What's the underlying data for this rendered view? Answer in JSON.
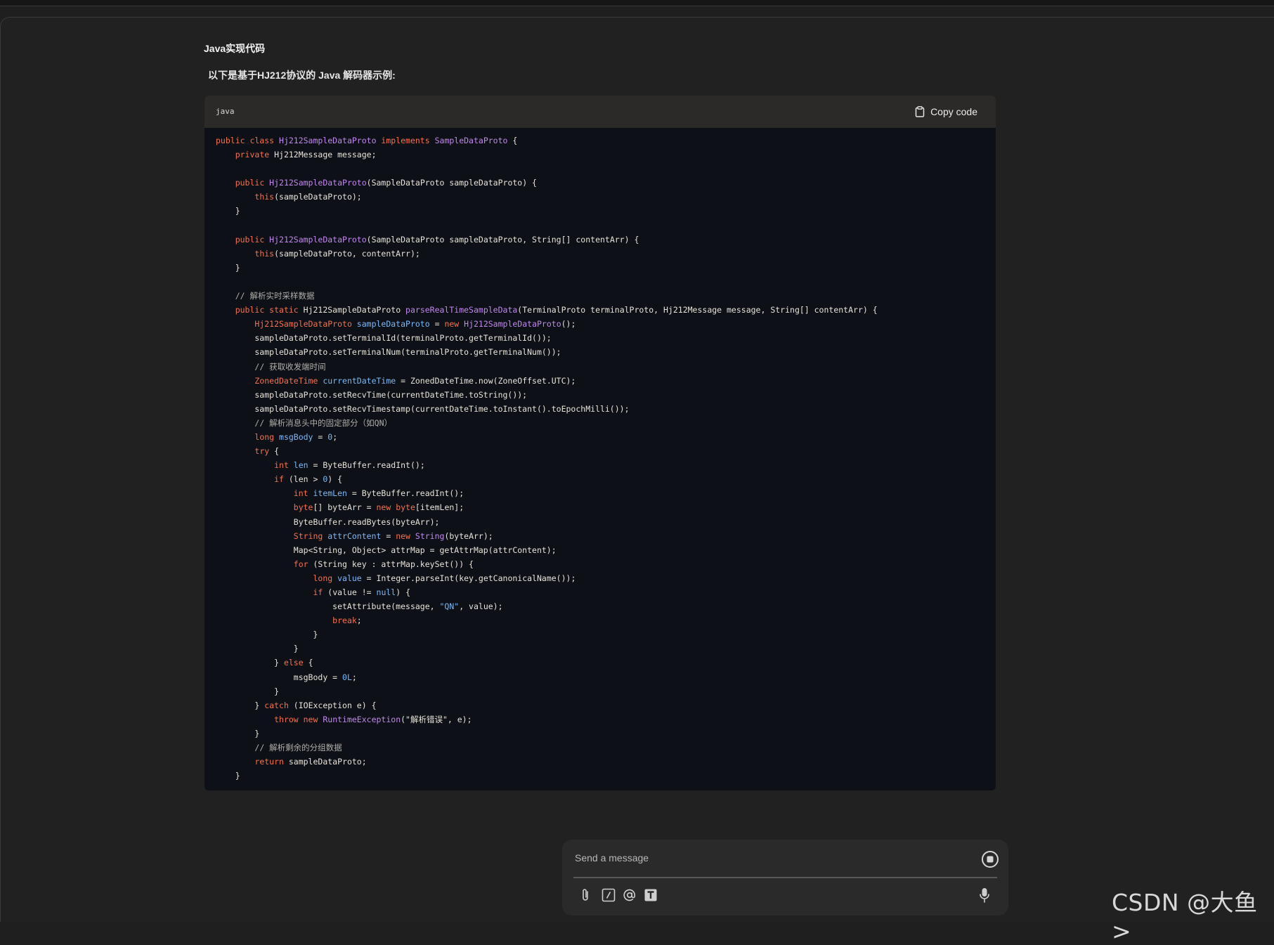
{
  "page": {
    "heading": "Java实现代码",
    "intro": "以下是基于HJ212协议的 Java 解码器示例:"
  },
  "code_block": {
    "language": "java",
    "copy_label": "Copy code",
    "lines": [
      [
        {
          "t": "public class ",
          "c": "kw"
        },
        {
          "t": "Hj212SampleDataProto ",
          "c": "cls"
        },
        {
          "t": "implements ",
          "c": "kw"
        },
        {
          "t": "SampleDataProto",
          "c": "cls"
        },
        {
          "t": " {"
        }
      ],
      [
        {
          "t": "    "
        },
        {
          "t": "private ",
          "c": "kw"
        },
        {
          "t": "Hj212Message message;"
        }
      ],
      [],
      [
        {
          "t": "    "
        },
        {
          "t": "public ",
          "c": "kw"
        },
        {
          "t": "Hj212SampleDataProto",
          "c": "cls"
        },
        {
          "t": "(SampleDataProto sampleDataProto) {"
        }
      ],
      [
        {
          "t": "        "
        },
        {
          "t": "this",
          "c": "kw"
        },
        {
          "t": "(sampleDataProto);"
        }
      ],
      [
        {
          "t": "    }"
        }
      ],
      [],
      [
        {
          "t": "    "
        },
        {
          "t": "public ",
          "c": "kw"
        },
        {
          "t": "Hj212SampleDataProto",
          "c": "cls"
        },
        {
          "t": "(SampleDataProto sampleDataProto, String[] contentArr) {"
        }
      ],
      [
        {
          "t": "        "
        },
        {
          "t": "this",
          "c": "kw"
        },
        {
          "t": "(sampleDataProto, contentArr);"
        }
      ],
      [
        {
          "t": "    }"
        }
      ],
      [],
      [
        {
          "t": "    "
        },
        {
          "t": "// 解析实时采样数据",
          "c": "cm"
        }
      ],
      [
        {
          "t": "    "
        },
        {
          "t": "public static ",
          "c": "kw"
        },
        {
          "t": "Hj212SampleDataProto "
        },
        {
          "t": "parseRealTimeSampleData",
          "c": "cls"
        },
        {
          "t": "(TerminalProto terminalProto, Hj212Message message, String[] contentArr) {"
        }
      ],
      [
        {
          "t": "        "
        },
        {
          "t": "Hj212SampleDataProto ",
          "c": "kw"
        },
        {
          "t": "sampleDataProto",
          "c": "nm"
        },
        {
          "t": " = "
        },
        {
          "t": "new ",
          "c": "kw"
        },
        {
          "t": "Hj212SampleDataProto",
          "c": "cls"
        },
        {
          "t": "();"
        }
      ],
      [
        {
          "t": "        sampleDataProto.setTerminalId(terminalProto.getTerminalId());"
        }
      ],
      [
        {
          "t": "        sampleDataProto.setTerminalNum(terminalProto.getTerminalNum());"
        }
      ],
      [
        {
          "t": "        "
        },
        {
          "t": "// 获取收发端时间",
          "c": "cm"
        }
      ],
      [
        {
          "t": "        "
        },
        {
          "t": "ZonedDateTime ",
          "c": "kw"
        },
        {
          "t": "currentDateTime",
          "c": "nm"
        },
        {
          "t": " = ZonedDateTime.now(ZoneOffset.UTC);"
        }
      ],
      [
        {
          "t": "        sampleDataProto.setRecvTime(currentDateTime.toString());"
        }
      ],
      [
        {
          "t": "        sampleDataProto.setRecvTimestamp(currentDateTime.toInstant().toEpochMilli());"
        }
      ],
      [
        {
          "t": "        "
        },
        {
          "t": "// 解析消息头中的固定部分（如QN）",
          "c": "cm"
        }
      ],
      [
        {
          "t": "        "
        },
        {
          "t": "long ",
          "c": "kw"
        },
        {
          "t": "msgBody",
          "c": "nm"
        },
        {
          "t": " = "
        },
        {
          "t": "0",
          "c": "nm"
        },
        {
          "t": ";"
        }
      ],
      [
        {
          "t": "        "
        },
        {
          "t": "try",
          "c": "kw"
        },
        {
          "t": " {"
        }
      ],
      [
        {
          "t": "            "
        },
        {
          "t": "int ",
          "c": "kw"
        },
        {
          "t": "len",
          "c": "nm"
        },
        {
          "t": " = ByteBuffer.readInt();"
        }
      ],
      [
        {
          "t": "            "
        },
        {
          "t": "if",
          "c": "kw"
        },
        {
          "t": " (len > "
        },
        {
          "t": "0",
          "c": "nm"
        },
        {
          "t": ") {"
        }
      ],
      [
        {
          "t": "                "
        },
        {
          "t": "int ",
          "c": "kw"
        },
        {
          "t": "itemLen",
          "c": "nm"
        },
        {
          "t": " = ByteBuffer.readInt();"
        }
      ],
      [
        {
          "t": "                "
        },
        {
          "t": "byte",
          "c": "kw"
        },
        {
          "t": "[] byteArr = "
        },
        {
          "t": "new ",
          "c": "kw"
        },
        {
          "t": "byte",
          "c": "kw"
        },
        {
          "t": "[itemLen];"
        }
      ],
      [
        {
          "t": "                ByteBuffer.readBytes(byteArr);"
        }
      ],
      [
        {
          "t": "                "
        },
        {
          "t": "String ",
          "c": "kw"
        },
        {
          "t": "attrContent",
          "c": "nm"
        },
        {
          "t": " = "
        },
        {
          "t": "new ",
          "c": "kw"
        },
        {
          "t": "String",
          "c": "cls"
        },
        {
          "t": "(byteArr);"
        }
      ],
      [
        {
          "t": "                Map<String, Object> attrMap = getAttrMap(attrContent);"
        }
      ],
      [
        {
          "t": "                "
        },
        {
          "t": "for",
          "c": "kw"
        },
        {
          "t": " (String key : attrMap.keySet()) {"
        }
      ],
      [
        {
          "t": "                    "
        },
        {
          "t": "long ",
          "c": "kw"
        },
        {
          "t": "value",
          "c": "nm"
        },
        {
          "t": " = Integer.parseInt(key.getCanonicalName());"
        }
      ],
      [
        {
          "t": "                    "
        },
        {
          "t": "if",
          "c": "kw"
        },
        {
          "t": " (value != "
        },
        {
          "t": "null",
          "c": "nm"
        },
        {
          "t": ") {"
        }
      ],
      [
        {
          "t": "                        setAttribute(message, "
        },
        {
          "t": "\"QN\"",
          "c": "nm"
        },
        {
          "t": ", value);"
        }
      ],
      [
        {
          "t": "                        "
        },
        {
          "t": "break",
          "c": "kw"
        },
        {
          "t": ";"
        }
      ],
      [
        {
          "t": "                    }"
        }
      ],
      [
        {
          "t": "                }"
        }
      ],
      [
        {
          "t": "            } "
        },
        {
          "t": "else",
          "c": "kw"
        },
        {
          "t": " {"
        }
      ],
      [
        {
          "t": "                msgBody = "
        },
        {
          "t": "0L",
          "c": "nm"
        },
        {
          "t": ";"
        }
      ],
      [
        {
          "t": "            }"
        }
      ],
      [
        {
          "t": "        } "
        },
        {
          "t": "catch",
          "c": "kw"
        },
        {
          "t": " (IOException e) {"
        }
      ],
      [
        {
          "t": "            "
        },
        {
          "t": "throw new ",
          "c": "kw"
        },
        {
          "t": "RuntimeException",
          "c": "cls"
        },
        {
          "t": "(\"解析错误\", e);"
        }
      ],
      [
        {
          "t": "        }"
        }
      ],
      [
        {
          "t": "        "
        },
        {
          "t": "// 解析剩余的分组数据",
          "c": "cm"
        }
      ],
      [
        {
          "t": "        "
        },
        {
          "t": "return",
          "c": "kw"
        },
        {
          "t": " sampleDataProto;"
        }
      ],
      [
        {
          "t": "    }"
        }
      ]
    ]
  },
  "composer": {
    "placeholder": "Send a message",
    "icons": [
      "paperclip-icon",
      "slash-command-icon",
      "mention-icon",
      "text-format-icon",
      "microphone-icon",
      "stop-icon"
    ]
  },
  "watermark": "CSDN @大鱼>"
}
